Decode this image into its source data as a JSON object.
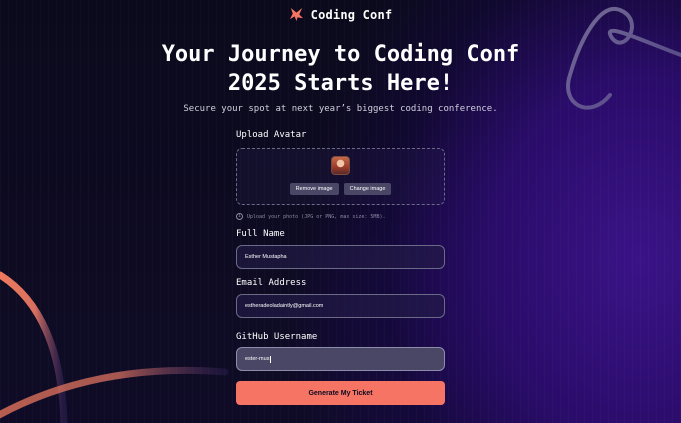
{
  "header": {
    "brand": "Coding Conf",
    "logo_icon": "coding-conf-logo-icon"
  },
  "hero": {
    "title_line1": "Your Journey to Coding Conf",
    "title_line2": "2025 Starts Here!",
    "subtitle": "Secure your spot at next year’s biggest coding conference."
  },
  "form": {
    "avatar": {
      "label": "Upload Avatar",
      "remove_label": "Remove image",
      "change_label": "Change image",
      "hint": "Upload your photo (JPG or PNG, max size: 5MB)."
    },
    "full_name": {
      "label": "Full Name",
      "value": "Esther Mustapha"
    },
    "email": {
      "label": "Email Address",
      "value": "estheradeoladaintly@gmail.com"
    },
    "github": {
      "label": "GitHub Username",
      "value": "ester-mus"
    },
    "submit_label": "Generate My Ticket"
  },
  "colors": {
    "accent": "#f57463",
    "background": "#0d0a1f",
    "purple_glow": "#3a1387",
    "input_bg": "#4a4766"
  }
}
